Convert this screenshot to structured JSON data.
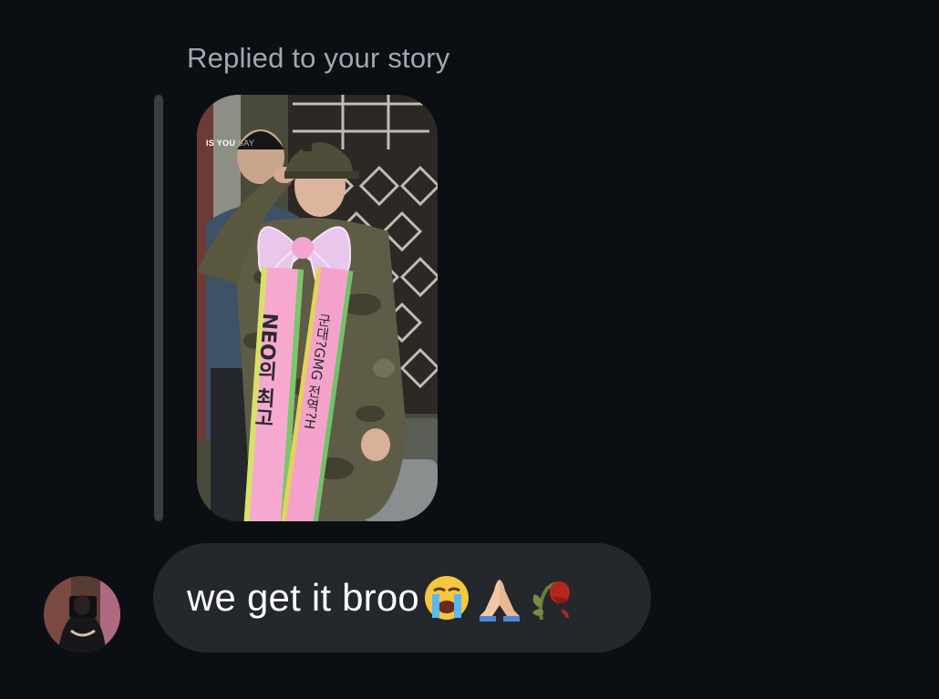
{
  "reply_context": {
    "label": "Replied to your story"
  },
  "story": {
    "caption_bold": "IS YOU",
    "caption_dim": "SAY",
    "sash_left": "NEO의 최고",
    "sash_right": "군대?GMG 전역?H"
  },
  "message": {
    "text": "we get it broo",
    "emojis": [
      "loudly-crying-face-icon",
      "folded-hands-icon",
      "wilted-flower-icon"
    ]
  },
  "colors": {
    "background": "#0b0f14",
    "bubble": "#24272b",
    "label": "#a3a8b0",
    "quote_bar": "#3a3d42"
  }
}
